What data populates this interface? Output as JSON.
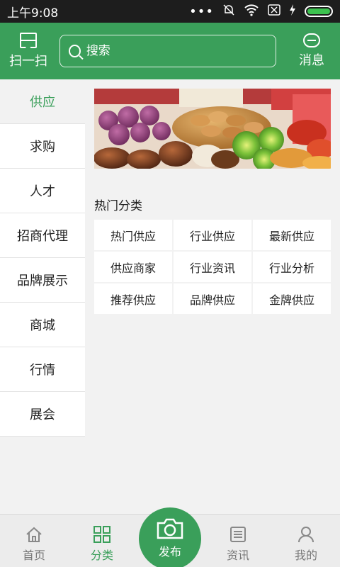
{
  "statusbar": {
    "time": "上午9:08"
  },
  "header": {
    "scan_label": "扫一扫",
    "search_placeholder": "搜索",
    "message_label": "消息"
  },
  "leftnav": {
    "items": [
      {
        "label": "供应",
        "active": true
      },
      {
        "label": "求购"
      },
      {
        "label": "人才"
      },
      {
        "label": "招商代理"
      },
      {
        "label": "品牌展示"
      },
      {
        "label": "商城"
      },
      {
        "label": "行情"
      },
      {
        "label": "展会"
      }
    ]
  },
  "main": {
    "section_title": "热门分类",
    "categories": [
      "热门供应",
      "行业供应",
      "最新供应",
      "供应商家",
      "行业资讯",
      "行业分析",
      "推荐供应",
      "品牌供应",
      "金牌供应"
    ]
  },
  "bottombar": {
    "tabs": [
      {
        "label": "首页"
      },
      {
        "label": "分类",
        "active": true
      },
      {
        "label": "发布"
      },
      {
        "label": "资讯"
      },
      {
        "label": "我的"
      }
    ]
  },
  "colors": {
    "brand": "#3a9f5a",
    "statusbar": "#1d1d1d",
    "background": "#f2f2f2"
  }
}
